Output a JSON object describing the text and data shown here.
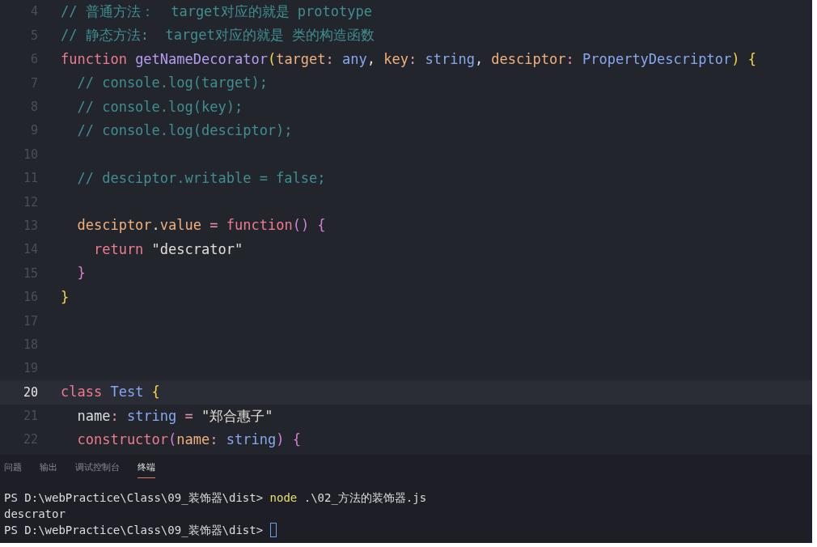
{
  "editor": {
    "lines": [
      {
        "number": "4",
        "current": false,
        "tokens": [
          {
            "text": "// 普通方法：  target对应的就是 prototype",
            "kind": "comment"
          }
        ]
      },
      {
        "number": "5",
        "current": false,
        "tokens": [
          {
            "text": "// 静态方法:  target对应的就是 类的构造函数",
            "kind": "comment"
          }
        ]
      },
      {
        "number": "6",
        "current": false,
        "tokens": [
          {
            "text": "function ",
            "kind": "keyword"
          },
          {
            "text": "getNameDecorator",
            "kind": "function"
          },
          {
            "text": "(",
            "kind": "bracket"
          },
          {
            "text": "target",
            "kind": "param"
          },
          {
            "text": ": ",
            "kind": "punct"
          },
          {
            "text": "any",
            "kind": "type"
          },
          {
            "text": ", ",
            "kind": "plain"
          },
          {
            "text": "key",
            "kind": "param"
          },
          {
            "text": ": ",
            "kind": "punct"
          },
          {
            "text": "string",
            "kind": "type"
          },
          {
            "text": ", ",
            "kind": "plain"
          },
          {
            "text": "desciptor",
            "kind": "param"
          },
          {
            "text": ": ",
            "kind": "punct"
          },
          {
            "text": "PropertyDescriptor",
            "kind": "type"
          },
          {
            "text": ") {",
            "kind": "bracket"
          }
        ]
      },
      {
        "number": "7",
        "current": false,
        "tokens": [
          {
            "text": "  // console.log(target);",
            "kind": "comment"
          }
        ]
      },
      {
        "number": "8",
        "current": false,
        "tokens": [
          {
            "text": "  // console.log(key);",
            "kind": "comment"
          }
        ]
      },
      {
        "number": "9",
        "current": false,
        "tokens": [
          {
            "text": "  // console.log(desciptor);",
            "kind": "comment"
          }
        ]
      },
      {
        "number": "10",
        "current": false
      },
      {
        "number": "11",
        "current": false,
        "tokens": [
          {
            "text": "  // desciptor.writable = false;",
            "kind": "comment"
          }
        ]
      },
      {
        "number": "12",
        "current": false
      },
      {
        "number": "13",
        "current": false,
        "tokens": [
          {
            "text": "  desciptor",
            "kind": "param"
          },
          {
            "text": ".",
            "kind": "plain"
          },
          {
            "text": "value",
            "kind": "param"
          },
          {
            "text": " = ",
            "kind": "punct"
          },
          {
            "text": "function",
            "kind": "keyword"
          },
          {
            "text": "() {",
            "kind": "bracket2"
          }
        ]
      },
      {
        "number": "14",
        "current": false,
        "tokens": [
          {
            "text": "    return ",
            "kind": "keyword"
          },
          {
            "text": "\"descrator\"",
            "kind": "string"
          }
        ]
      },
      {
        "number": "15",
        "current": false,
        "tokens": [
          {
            "text": "  }",
            "kind": "bracket2"
          }
        ]
      },
      {
        "number": "16",
        "current": false,
        "tokens": [
          {
            "text": "}",
            "kind": "bracket"
          }
        ]
      },
      {
        "number": "17",
        "current": false
      },
      {
        "number": "18",
        "current": false
      },
      {
        "number": "19",
        "current": false
      },
      {
        "number": "20",
        "current": true,
        "tokens": [
          {
            "text": "class ",
            "kind": "keyword"
          },
          {
            "text": "Test ",
            "kind": "type"
          },
          {
            "text": "{",
            "kind": "bracket"
          }
        ]
      },
      {
        "number": "21",
        "current": false,
        "tokens": [
          {
            "text": "  name",
            "kind": "plain"
          },
          {
            "text": ": ",
            "kind": "punct"
          },
          {
            "text": "string",
            "kind": "type"
          },
          {
            "text": " = ",
            "kind": "punct"
          },
          {
            "text": "\"郑合惠子\"",
            "kind": "string"
          }
        ]
      },
      {
        "number": "22",
        "current": false,
        "tokens": [
          {
            "text": "  constructor",
            "kind": "keyword"
          },
          {
            "text": "(",
            "kind": "bracket2"
          },
          {
            "text": "name",
            "kind": "param"
          },
          {
            "text": ": ",
            "kind": "punct"
          },
          {
            "text": "string",
            "kind": "type"
          },
          {
            "text": ") {",
            "kind": "bracket2"
          }
        ]
      }
    ]
  },
  "panel": {
    "tabs": [
      {
        "label": "问题",
        "selected": false
      },
      {
        "label": "输出",
        "selected": false
      },
      {
        "label": "调试控制台",
        "selected": false
      },
      {
        "label": "终端",
        "selected": true
      }
    ],
    "terminal": [
      {
        "tokens": [
          {
            "text": "PS D:\\webPractice\\Class\\09_装饰器\\dist> ",
            "kind": "plain"
          },
          {
            "text": "node",
            "kind": "command"
          },
          {
            "text": " .\\02_方法的装饰器.js",
            "kind": "plain"
          }
        ],
        "cursor": false
      },
      {
        "tokens": [
          {
            "text": "descrator",
            "kind": "plain"
          }
        ],
        "cursor": false
      },
      {
        "tokens": [
          {
            "text": "PS D:\\webPractice\\Class\\09_装饰器\\dist> ",
            "kind": "plain"
          }
        ],
        "cursor": true
      }
    ]
  }
}
